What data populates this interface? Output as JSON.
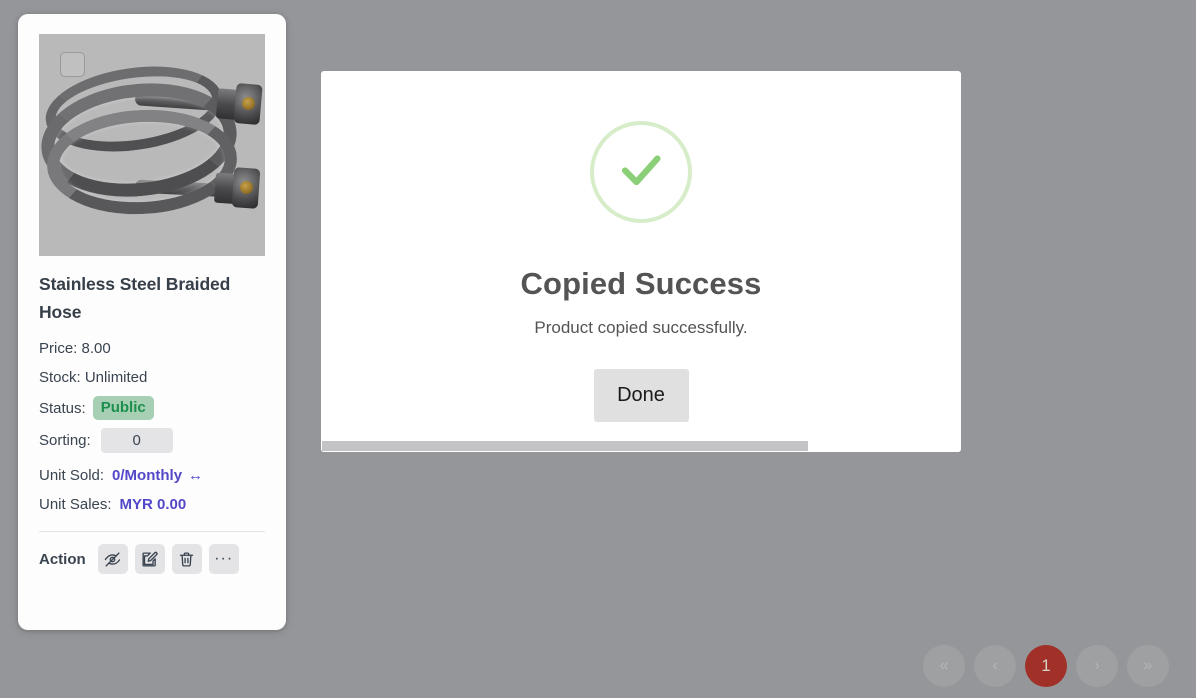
{
  "product_card": {
    "checkbox": {
      "name": "select-product-checkbox",
      "checked": false
    },
    "image_alt": "Stainless Steel Braided Hose product photo",
    "title": "Stainless Steel Braided Hose",
    "price_line": "Price: 8.00",
    "stock_line": "Stock: Unlimited",
    "status_label": "Status:",
    "status_value": "Public",
    "status_color": "#1c8f4d",
    "status_bg": "#a7cfb4",
    "sorting_label": "Sorting:",
    "sorting_value": "0",
    "unit_sold_label": "Unit Sold:",
    "unit_sold_value": "0/Monthly",
    "unit_sold_arrow": "↔",
    "unit_sales_label": "Unit Sales:",
    "unit_sales_value": "MYR 0.00",
    "accent_color": "#5348c8",
    "action_label": "Action",
    "actions": [
      {
        "name": "hide-icon",
        "title": "Hide"
      },
      {
        "name": "edit-icon",
        "title": "Edit"
      },
      {
        "name": "trash-icon",
        "title": "Delete"
      },
      {
        "name": "more-options-icon",
        "title": "More",
        "glyph": "···"
      }
    ]
  },
  "modal": {
    "icon": "check-circle-icon",
    "icon_color": "#8ccf79",
    "icon_ring_color": "#d7edc9",
    "title": "Copied Success",
    "message": "Product copied successfully.",
    "button_label": "Done"
  },
  "pagination": {
    "first_label": "«",
    "prev_label": "‹",
    "pages": [
      {
        "label": "1",
        "active": true
      }
    ],
    "next_label": "›",
    "last_label": "»",
    "active_bg": "#a03028"
  }
}
